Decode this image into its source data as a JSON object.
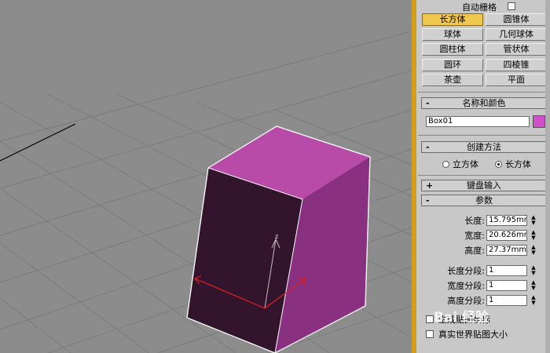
{
  "panel": {
    "autogrid_label": "自动栅格",
    "object_buttons": [
      {
        "label": "长方体",
        "active": true
      },
      {
        "label": "圆锥体"
      },
      {
        "label": "球体"
      },
      {
        "label": "几何球体"
      },
      {
        "label": "圆柱体"
      },
      {
        "label": "管状体"
      },
      {
        "label": "圆环"
      },
      {
        "label": "四棱锥"
      },
      {
        "label": "茶壶"
      },
      {
        "label": "平面"
      }
    ],
    "name_color": {
      "title": "名称和颜色",
      "sign": "-",
      "name_value": "Box01",
      "color": "#d050c8"
    },
    "creation": {
      "title": "创建方法",
      "sign": "-",
      "opt_cube": "立方体",
      "opt_box": "长方体",
      "selected": "长方体"
    },
    "keyboard": {
      "title": "键盘输入",
      "sign": "+"
    },
    "params": {
      "title": "参数",
      "sign": "-",
      "length_label": "长度:",
      "length_value": "15.795mm",
      "width_label": "宽度:",
      "width_value": "20.626mm",
      "height_label": "高度:",
      "height_value": "27.37mm",
      "length_segs_label": "长度分段:",
      "length_segs_value": "1",
      "width_segs_label": "宽度分段:",
      "width_segs_value": "1",
      "height_segs_label": "高度分段:",
      "height_segs_value": "1",
      "gen_mapping_label": "生成贴图坐标",
      "real_world_label": "真实世界贴图大小"
    }
  },
  "viewport": {
    "axis_label": "z",
    "box_top_color": "#b84aa8",
    "box_front_color": "#32142c",
    "box_side_color": "#8a3080",
    "gizmo_color": "#e02020"
  },
  "watermark": "Bai 经验"
}
